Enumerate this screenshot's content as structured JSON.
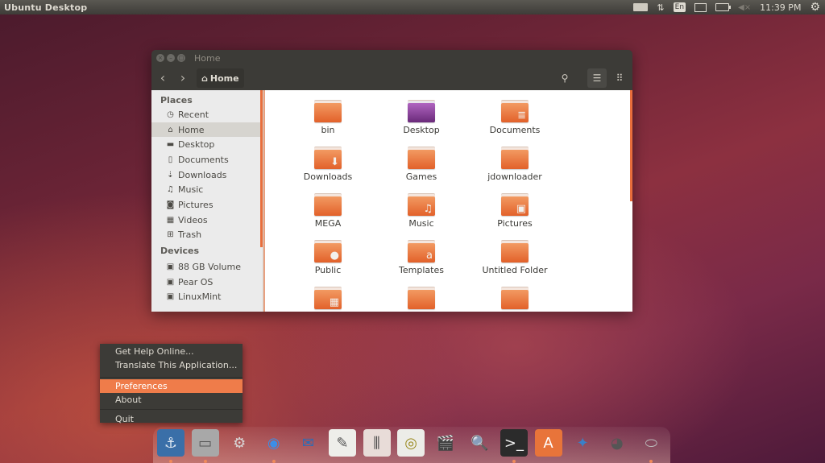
{
  "top_panel": {
    "title": "Ubuntu Desktop",
    "indicators": {
      "keyboard_icon": "keyboard-icon",
      "network_icon": "network-transfer-icon",
      "language": "En",
      "mail_icon": "mail-icon",
      "battery_icon": "battery-icon",
      "volume_icon": "volume-muted-icon",
      "clock": "11:39 PM",
      "session_icon": "gear-icon"
    }
  },
  "window": {
    "title": "Home",
    "toolbar": {
      "back": "‹",
      "forward": "›",
      "path_label": "Home",
      "search": "⚲",
      "list_view": "☰",
      "grid_view": "⠿"
    },
    "sidebar": {
      "places_header": "Places",
      "places": [
        {
          "label": "Recent",
          "icon": "◷"
        },
        {
          "label": "Home",
          "icon": "⌂",
          "selected": true
        },
        {
          "label": "Desktop",
          "icon": "▬"
        },
        {
          "label": "Documents",
          "icon": "▯"
        },
        {
          "label": "Downloads",
          "icon": "⇣"
        },
        {
          "label": "Music",
          "icon": "♫"
        },
        {
          "label": "Pictures",
          "icon": "◙"
        },
        {
          "label": "Videos",
          "icon": "▦"
        },
        {
          "label": "Trash",
          "icon": "⊞"
        }
      ],
      "devices_header": "Devices",
      "devices": [
        {
          "label": "88 GB Volume",
          "icon": "▣"
        },
        {
          "label": "Pear OS",
          "icon": "▣"
        },
        {
          "label": "LinuxMint",
          "icon": "▣"
        }
      ]
    },
    "files": [
      {
        "name": "bin",
        "emblem": ""
      },
      {
        "name": "Desktop",
        "emblem": "",
        "style": "purple"
      },
      {
        "name": "Documents",
        "emblem": "≣"
      },
      {
        "name": "Downloads",
        "emblem": "⬇"
      },
      {
        "name": "Games",
        "emblem": ""
      },
      {
        "name": "jdownloader",
        "emblem": ""
      },
      {
        "name": "MEGA",
        "emblem": ""
      },
      {
        "name": "Music",
        "emblem": "♫"
      },
      {
        "name": "Pictures",
        "emblem": "▣"
      },
      {
        "name": "Public",
        "emblem": "●"
      },
      {
        "name": "Templates",
        "emblem": "a"
      },
      {
        "name": "Untitled Folder",
        "emblem": ""
      },
      {
        "name": "",
        "emblem": "▦"
      },
      {
        "name": "",
        "emblem": ""
      },
      {
        "name": "",
        "emblem": ""
      }
    ]
  },
  "context_menu": {
    "items": [
      {
        "label": "Get Help Online..."
      },
      {
        "label": "Translate This Application..."
      },
      {
        "label": "Preferences",
        "highlighted": true
      },
      {
        "label": "About"
      },
      {
        "label": "Quit"
      }
    ]
  },
  "dock": {
    "items": [
      {
        "name": "anchor-app",
        "glyph": "⚓",
        "bg": "#3a6fa8",
        "color": "#dfe8f2",
        "running": true
      },
      {
        "name": "file-cabinet",
        "glyph": "▭",
        "bg": "#a8a8a8",
        "color": "#555",
        "running": true
      },
      {
        "name": "system-settings",
        "glyph": "⚙",
        "bg": "transparent",
        "color": "#d8d8d8",
        "running": false
      },
      {
        "name": "chrome",
        "glyph": "◉",
        "bg": "transparent",
        "color": "#3b8ee8",
        "running": true
      },
      {
        "name": "thunderbird",
        "glyph": "✉",
        "bg": "transparent",
        "color": "#2a6cb8",
        "running": false
      },
      {
        "name": "text-editor",
        "glyph": "✎",
        "bg": "#eeeeea",
        "color": "#555",
        "running": false
      },
      {
        "name": "mixer",
        "glyph": "⫼",
        "bg": "#e8dcd8",
        "color": "#444",
        "running": false
      },
      {
        "name": "speaker",
        "glyph": "◎",
        "bg": "#ecece8",
        "color": "#9a8a20",
        "running": false
      },
      {
        "name": "video-editor",
        "glyph": "🎬",
        "bg": "transparent",
        "color": "#222",
        "running": false
      },
      {
        "name": "image-viewer",
        "glyph": "🔍",
        "bg": "transparent",
        "color": "#555",
        "running": false
      },
      {
        "name": "terminal",
        "glyph": ">_",
        "bg": "#2b2b2b",
        "color": "#eee",
        "running": true
      },
      {
        "name": "software-center",
        "glyph": "A",
        "bg": "#e8743a",
        "color": "#fff",
        "running": false
      },
      {
        "name": "blue-swirl-app",
        "glyph": "✦",
        "bg": "transparent",
        "color": "#3a80c8",
        "running": false
      },
      {
        "name": "gimp",
        "glyph": "◕",
        "bg": "transparent",
        "color": "#555",
        "running": false
      },
      {
        "name": "backup-roller",
        "glyph": "⬭",
        "bg": "transparent",
        "color": "#bbb",
        "running": true
      }
    ]
  }
}
